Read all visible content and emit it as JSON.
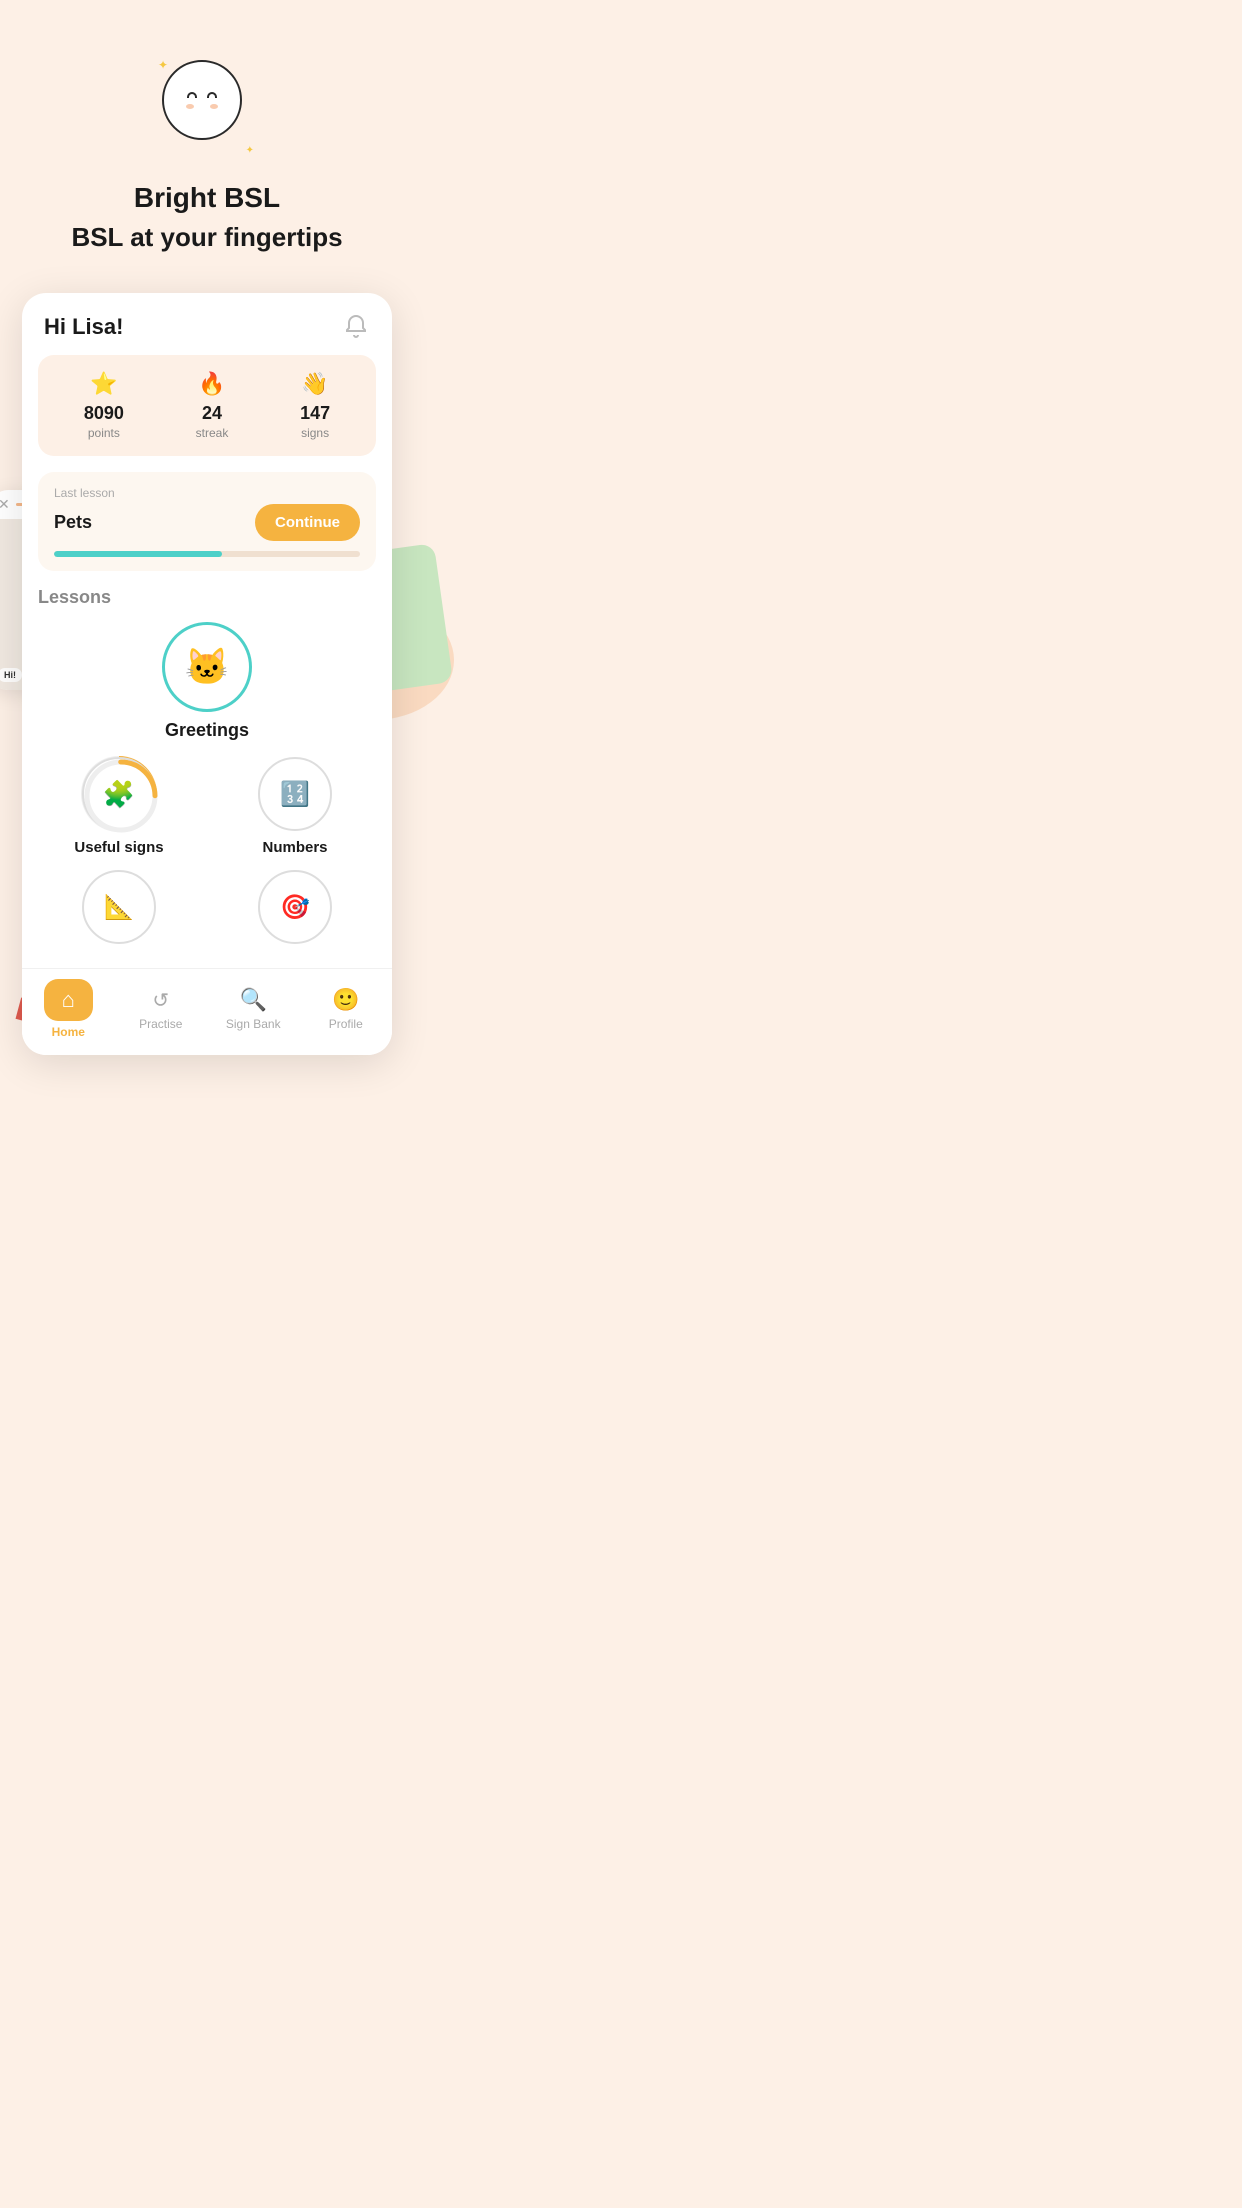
{
  "app": {
    "title": "Bright BSL",
    "subtitle": "BSL at your fingertips"
  },
  "screen": {
    "greeting": "Hi Lisa!",
    "stats": {
      "points": {
        "value": "8090",
        "label": "points",
        "icon": "⭐"
      },
      "streak": {
        "value": "24",
        "label": "streak",
        "icon": "🔥"
      },
      "signs": {
        "value": "147",
        "label": "signs",
        "icon": "👋"
      }
    },
    "last_lesson": {
      "label": "Last lesson",
      "title": "Pets",
      "continue_button": "Continue",
      "progress_percent": 55
    },
    "lessons_label": "Lessons",
    "lessons": [
      {
        "id": "greetings",
        "name": "Greetings",
        "size": "large",
        "icon": "🐱",
        "border_color": "#4dd0c8",
        "has_progress": false
      },
      {
        "id": "useful-signs",
        "name": "Useful signs",
        "size": "small",
        "icon": "🧩",
        "has_progress": true,
        "progress_deg": 120
      },
      {
        "id": "numbers",
        "name": "Numbers",
        "size": "small",
        "icon": "🔢",
        "has_progress": false
      },
      {
        "id": "lesson4",
        "name": "",
        "size": "small",
        "icon": "📐",
        "has_progress": false
      },
      {
        "id": "lesson5",
        "name": "",
        "size": "small",
        "icon": "🎯",
        "has_progress": false
      }
    ],
    "nav": {
      "items": [
        {
          "id": "home",
          "label": "Home",
          "icon": "🏠",
          "active": true
        },
        {
          "id": "practise",
          "label": "Practise",
          "icon": "🔄",
          "active": false
        },
        {
          "id": "sign-bank",
          "label": "Sign Bank",
          "icon": "🔍",
          "active": false
        },
        {
          "id": "profile",
          "label": "Profile",
          "icon": "🙂",
          "active": false
        }
      ]
    }
  }
}
